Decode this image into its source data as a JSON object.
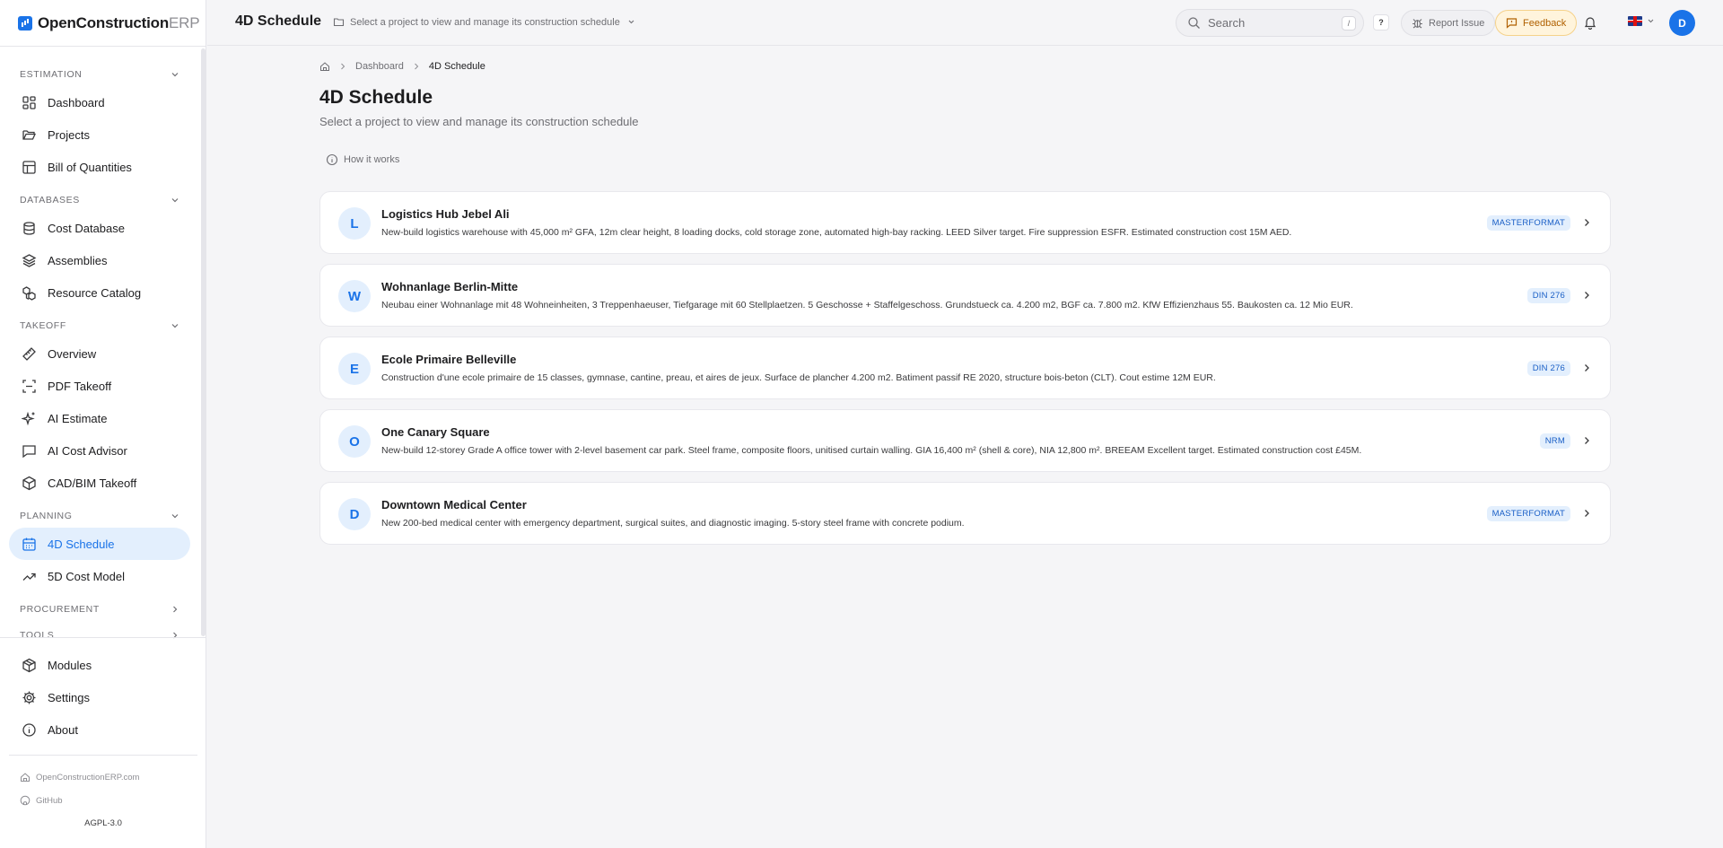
{
  "app": {
    "logo_text": "OpenConstruction",
    "logo_suffix": "ERP"
  },
  "header": {
    "title": "4D Schedule",
    "project_selector": "Select a project to view and manage its construction schedule",
    "search_placeholder": "Search",
    "search_shortcut": "/",
    "help_label": "?",
    "report_issue": "Report Issue",
    "feedback": "Feedback",
    "avatar_initial": "D"
  },
  "sidebar": {
    "sections": {
      "estimation": "ESTIMATION",
      "databases": "DATABASES",
      "takeoff": "TAKEOFF",
      "planning": "PLANNING",
      "procurement": "PROCUREMENT",
      "tools": "TOOLS"
    },
    "items": {
      "dashboard": "Dashboard",
      "projects": "Projects",
      "boq": "Bill of Quantities",
      "cost_database": "Cost Database",
      "assemblies": "Assemblies",
      "resource_catalog": "Resource Catalog",
      "overview": "Overview",
      "pdf_takeoff": "PDF Takeoff",
      "ai_estimate": "AI Estimate",
      "ai_cost_advisor": "AI Cost Advisor",
      "cad_bim_takeoff": "CAD/BIM Takeoff",
      "schedule_4d": "4D Schedule",
      "cost_model_5d": "5D Cost Model"
    },
    "bottom": {
      "modules": "Modules",
      "settings": "Settings",
      "about": "About"
    },
    "footer": {
      "website": "OpenConstructionERP.com",
      "github": "GitHub",
      "license": "AGPL-3.0"
    }
  },
  "breadcrumb": {
    "dashboard": "Dashboard",
    "current": "4D Schedule"
  },
  "main": {
    "title": "4D Schedule",
    "subtitle": "Select a project to view and manage its construction schedule",
    "how_it_works": "How it works",
    "projects": [
      {
        "initial": "L",
        "name": "Logistics Hub Jebel Ali",
        "description": "New-build logistics warehouse with 45,000 m² GFA, 12m clear height, 8 loading docks, cold storage zone, automated high-bay racking. LEED Silver target. Fire suppression ESFR. Estimated construction cost 15M AED.",
        "standard": "MASTERFORMAT"
      },
      {
        "initial": "W",
        "name": "Wohnanlage Berlin-Mitte",
        "description": "Neubau einer Wohnanlage mit 48 Wohneinheiten, 3 Treppenhaeuser, Tiefgarage mit 60 Stellplaetzen. 5 Geschosse + Staffelgeschoss. Grundstueck ca. 4.200 m2, BGF ca. 7.800 m2. KfW Effizienzhaus 55. Baukosten ca. 12 Mio EUR.",
        "standard": "DIN 276"
      },
      {
        "initial": "E",
        "name": "Ecole Primaire Belleville",
        "description": "Construction d'une ecole primaire de 15 classes, gymnase, cantine, preau, et aires de jeux. Surface de plancher 4.200 m2. Batiment passif RE 2020, structure bois-beton (CLT). Cout estime 12M EUR.",
        "standard": "DIN 276"
      },
      {
        "initial": "O",
        "name": "One Canary Square",
        "description": "New-build 12-storey Grade A office tower with 2-level basement car park. Steel frame, composite floors, unitised curtain walling. GIA 16,400 m² (shell & core), NIA 12,800 m². BREEAM Excellent target. Estimated construction cost £45M.",
        "standard": "NRM"
      },
      {
        "initial": "D",
        "name": "Downtown Medical Center",
        "description": "New 200-bed medical center with emergency department, surgical suites, and diagnostic imaging. 5-story steel frame with concrete podium.",
        "standard": "MASTERFORMAT"
      }
    ]
  },
  "colors": {
    "accent": "#1a73e8",
    "active_bg": "#e3effd",
    "feedback_bg": "#fff4dc",
    "feedback_text": "#b06000"
  }
}
